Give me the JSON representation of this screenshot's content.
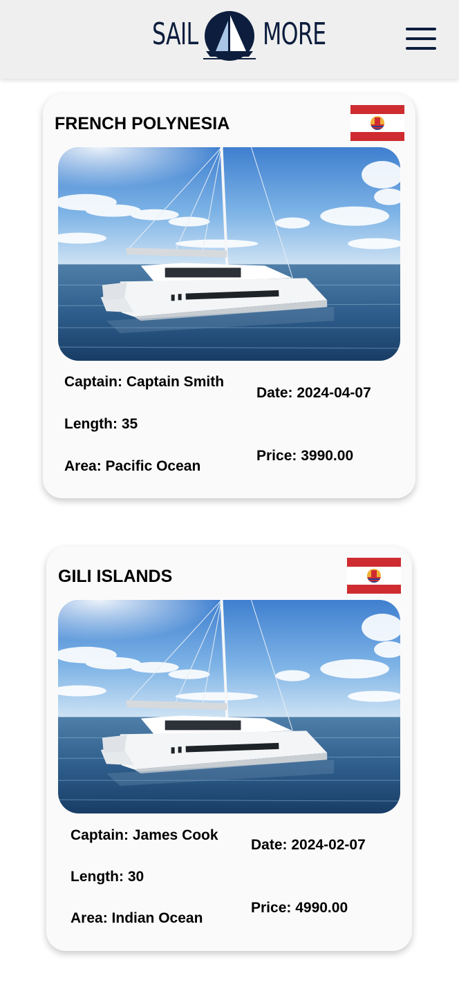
{
  "header": {
    "logo_left": "SAIL",
    "logo_right": "MORE",
    "menu_icon": "hamburger-menu-icon"
  },
  "colors": {
    "brand_navy": "#0c1d3d",
    "header_bg": "#efefef",
    "card_bg": "#fafafa",
    "flag_red": "#ce2c30"
  },
  "trips": [
    {
      "title": "FRENCH POLYNESIA",
      "flag_icon": "french-polynesia-flag-icon",
      "image": "catamaran-photo",
      "captain_label": "Captain:",
      "captain": "Captain Smith",
      "length_label": "Length:",
      "length": "35",
      "area_label": "Area:",
      "area": "Pacific Ocean",
      "date_label": "Date:",
      "date": "2024-04-07",
      "price_label": "Price:",
      "price": "3990.00"
    },
    {
      "title": "GILI ISLANDS",
      "flag_icon": "french-polynesia-flag-icon",
      "image": "catamaran-photo",
      "captain_label": "Captain:",
      "captain": "James Cook",
      "length_label": "Length:",
      "length": "30",
      "area_label": "Area:",
      "area": "Indian Ocean",
      "date_label": "Date:",
      "date": "2024-02-07",
      "price_label": "Price:",
      "price": "4990.00"
    }
  ]
}
